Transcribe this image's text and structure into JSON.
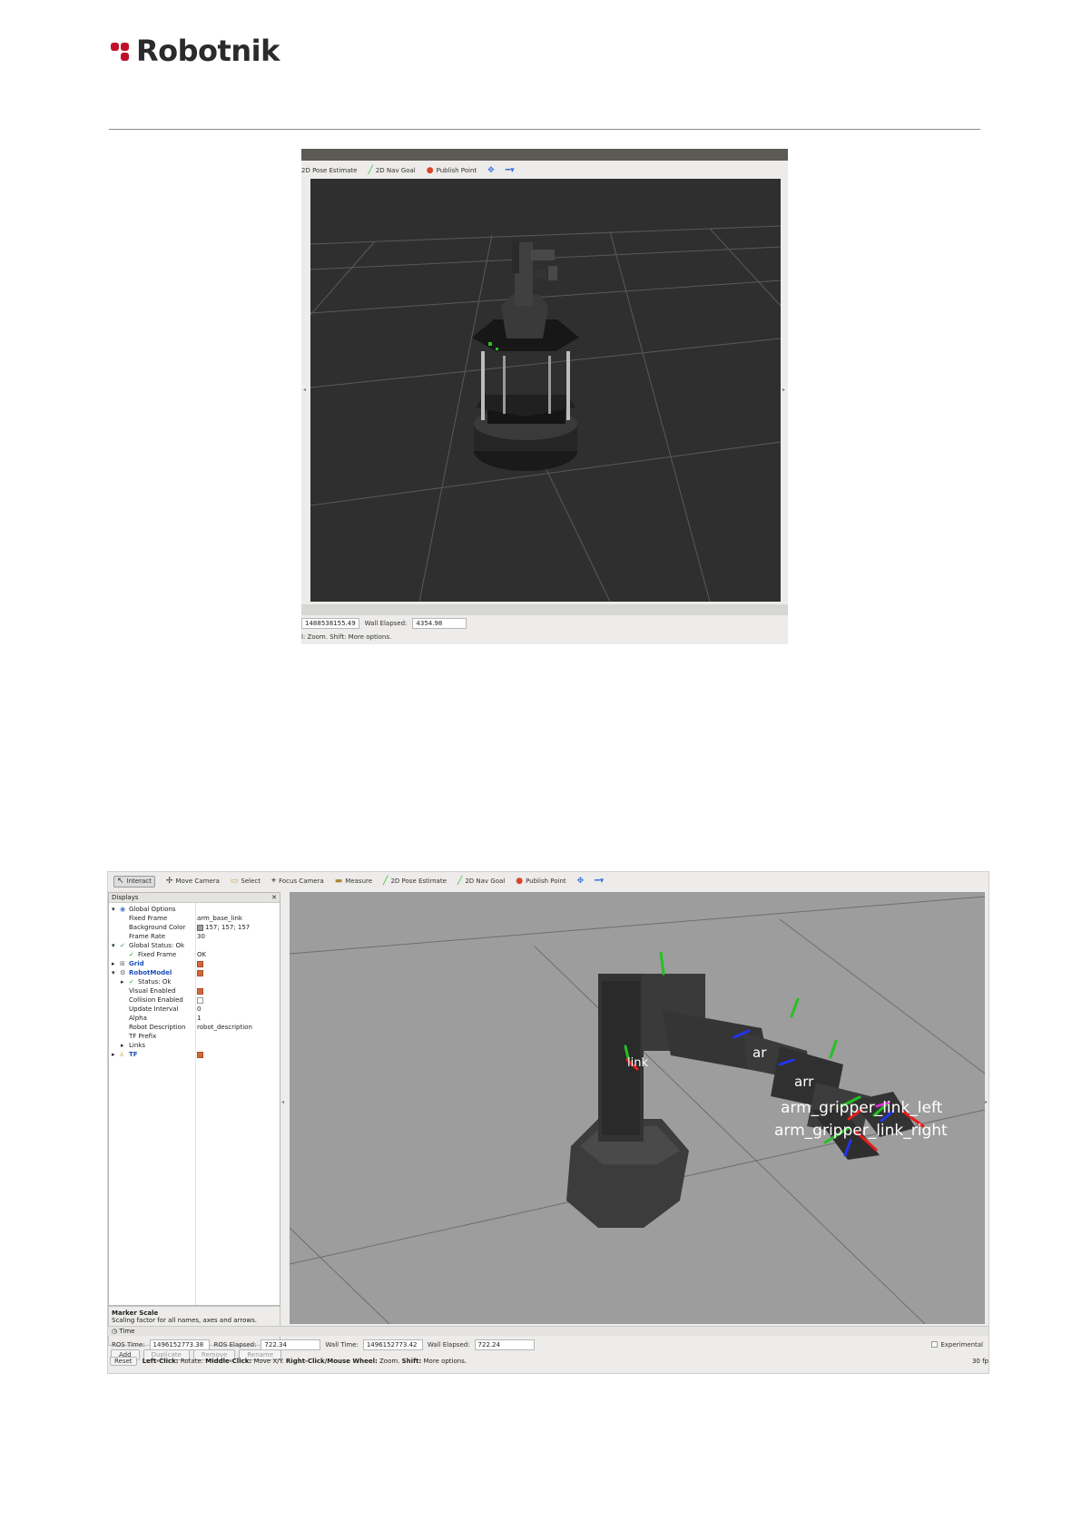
{
  "brand": {
    "name": "Robotnik",
    "color": "#c0102a"
  },
  "shot1": {
    "toolbar": [
      {
        "icon": "pose-estimate-icon",
        "label": "2D Pose Estimate"
      },
      {
        "icon": "nav-goal-icon",
        "label": "2D Nav Goal"
      },
      {
        "icon": "publish-point-icon",
        "label": "Publish Point"
      }
    ],
    "time": {
      "ros_time_value": "1488538155.49",
      "wall_elapsed_label": "Wall Elapsed:",
      "wall_elapsed_value": "4354.98"
    },
    "hint": "l: Zoom. Shift: More options."
  },
  "shot2": {
    "toolbar": {
      "interact": "Interact",
      "move_camera": "Move Camera",
      "select": "Select",
      "focus_camera": "Focus Camera",
      "measure": "Measure",
      "pose_estimate": "2D Pose Estimate",
      "nav_goal": "2D Nav Goal",
      "publish_point": "Publish Point"
    },
    "displays": {
      "title": "Displays",
      "global_options": "Global Options",
      "fixed_frame_label": "Fixed Frame",
      "fixed_frame_value": "arm_base_link",
      "bg_color_label": "Background Color",
      "bg_color_value": "157; 157; 157",
      "frame_rate_label": "Frame Rate",
      "frame_rate_value": "30",
      "global_status": "Global Status: Ok",
      "fixed_frame_status_label": "Fixed Frame",
      "fixed_frame_status_value": "OK",
      "grid": "Grid",
      "robot_model": "RobotModel",
      "status_ok": "Status: Ok",
      "visual_enabled": "Visual Enabled",
      "collision_enabled": "Collision Enabled",
      "update_interval_label": "Update Interval",
      "update_interval_value": "0",
      "alpha_label": "Alpha",
      "alpha_value": "1",
      "robot_description_label": "Robot Description",
      "robot_description_value": "robot_description",
      "tf_prefix": "TF Prefix",
      "links": "Links",
      "tf": "TF"
    },
    "description": {
      "title": "Marker Scale",
      "text": "Scaling factor for all names, axes and arrows."
    },
    "buttons": {
      "add": "Add",
      "duplicate": "Duplicate",
      "remove": "Remove",
      "rename": "Rename"
    },
    "frames": {
      "link": "link",
      "ar1": "ar",
      "ar2": "arr",
      "left": "arm_gripper_link_left",
      "right": "arm_gripper_link_right"
    },
    "time": {
      "title": "Time",
      "ros_time_label": "ROS Time:",
      "ros_time_value": "1496152773.38",
      "ros_elapsed_label": "ROS Elapsed:",
      "ros_elapsed_value": "722.34",
      "wall_time_label": "Wall Time:",
      "wall_time_value": "1496152773.42",
      "wall_elapsed_label": "Wall Elapsed:",
      "wall_elapsed_value": "722.24",
      "experimental": "Experimental"
    },
    "status": {
      "reset": "Reset",
      "left_click": "Left-Click:",
      "left_click_text": "Rotate.",
      "middle_click": "Middle-Click:",
      "middle_click_text": "Move X/Y.",
      "right_click": "Right-Click/Mouse Wheel:",
      "right_click_text": "Zoom.",
      "shift": "Shift:",
      "shift_text": "More options.",
      "fps": "30 fp"
    }
  }
}
